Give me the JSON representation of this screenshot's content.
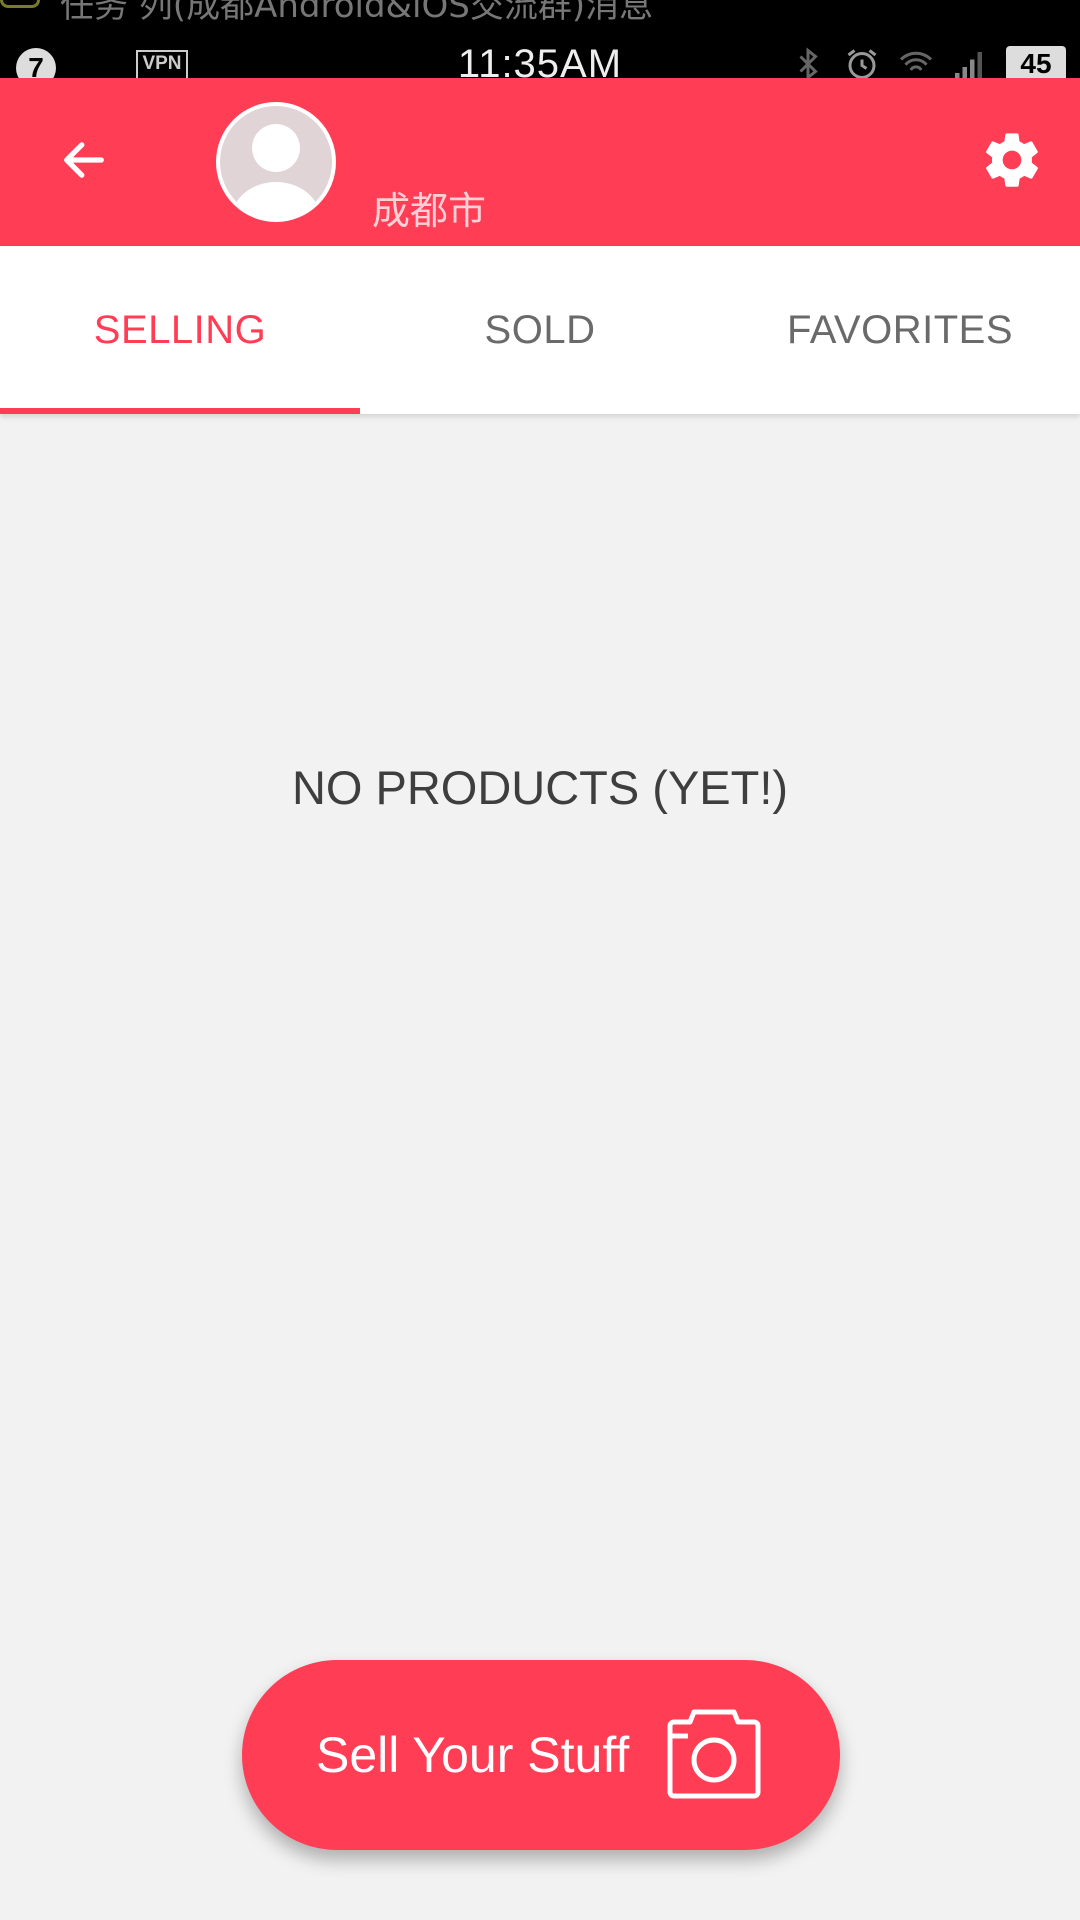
{
  "status_bar": {
    "ticker_text": "任务 列(成都Android&iOS交流群)消息",
    "notification_count": "7",
    "vpn": "VPN",
    "time": "11:35AM",
    "battery": "45"
  },
  "header": {
    "location": "成都市",
    "accent_color": "#ff3d55"
  },
  "tabs": [
    {
      "label": "SELLING",
      "active": true
    },
    {
      "label": "SOLD",
      "active": false
    },
    {
      "label": "FAVORITES",
      "active": false
    }
  ],
  "main": {
    "empty_message": "NO PRODUCTS (YET!)"
  },
  "fab": {
    "label": "Sell Your Stuff",
    "icon": "camera-icon"
  }
}
